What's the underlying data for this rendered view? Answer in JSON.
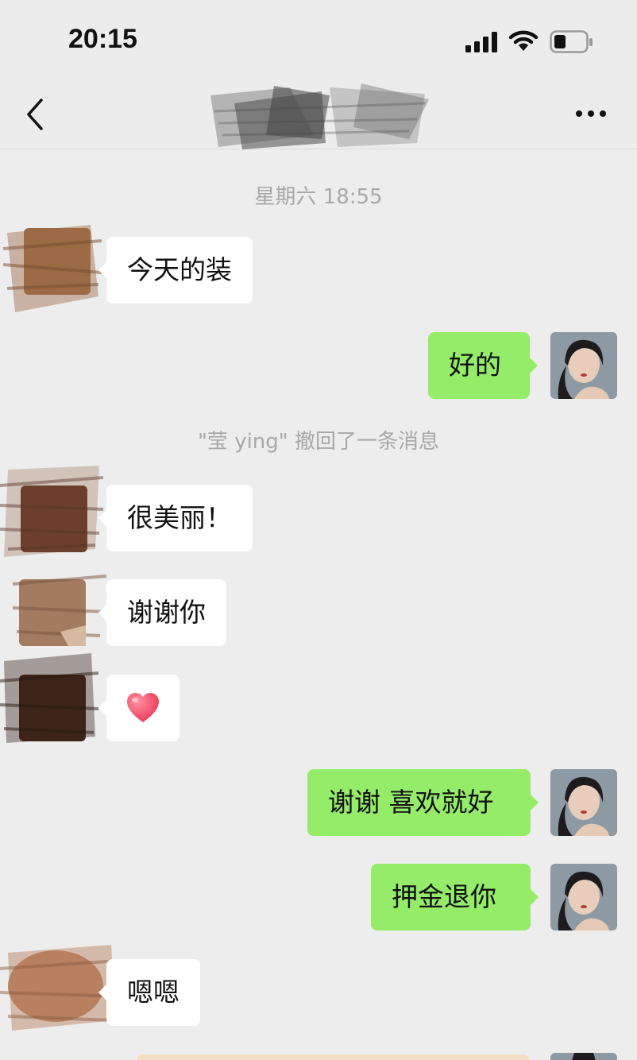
{
  "status": {
    "time": "20:15"
  },
  "nav": {
    "title_redacted": true
  },
  "chat": {
    "time_separator": "星期六 18:55",
    "recall_notice": "\"莹 ying\" 撤回了一条消息",
    "messages": [
      {
        "id": 1,
        "side": "in",
        "text": "今天的装"
      },
      {
        "id": 2,
        "side": "out",
        "text": "好的"
      },
      {
        "id": 3,
        "side": "in",
        "text": "很美丽！"
      },
      {
        "id": 4,
        "side": "in",
        "text": "谢谢你"
      },
      {
        "id": 5,
        "side": "in",
        "emoji": "heart"
      },
      {
        "id": 6,
        "side": "out",
        "text": "谢谢 喜欢就好"
      },
      {
        "id": 7,
        "side": "out",
        "text": "押金退你"
      },
      {
        "id": 8,
        "side": "in",
        "text": "嗯嗯"
      }
    ]
  },
  "colors": {
    "background": "#ededed",
    "bubble_in": "#ffffff",
    "bubble_out": "#95ec69",
    "meta_text": "#a8a8a8"
  },
  "icons": [
    "back-chevron-icon",
    "more-dots-icon",
    "signal-icon",
    "wifi-icon",
    "battery-icon",
    "heart-icon"
  ]
}
